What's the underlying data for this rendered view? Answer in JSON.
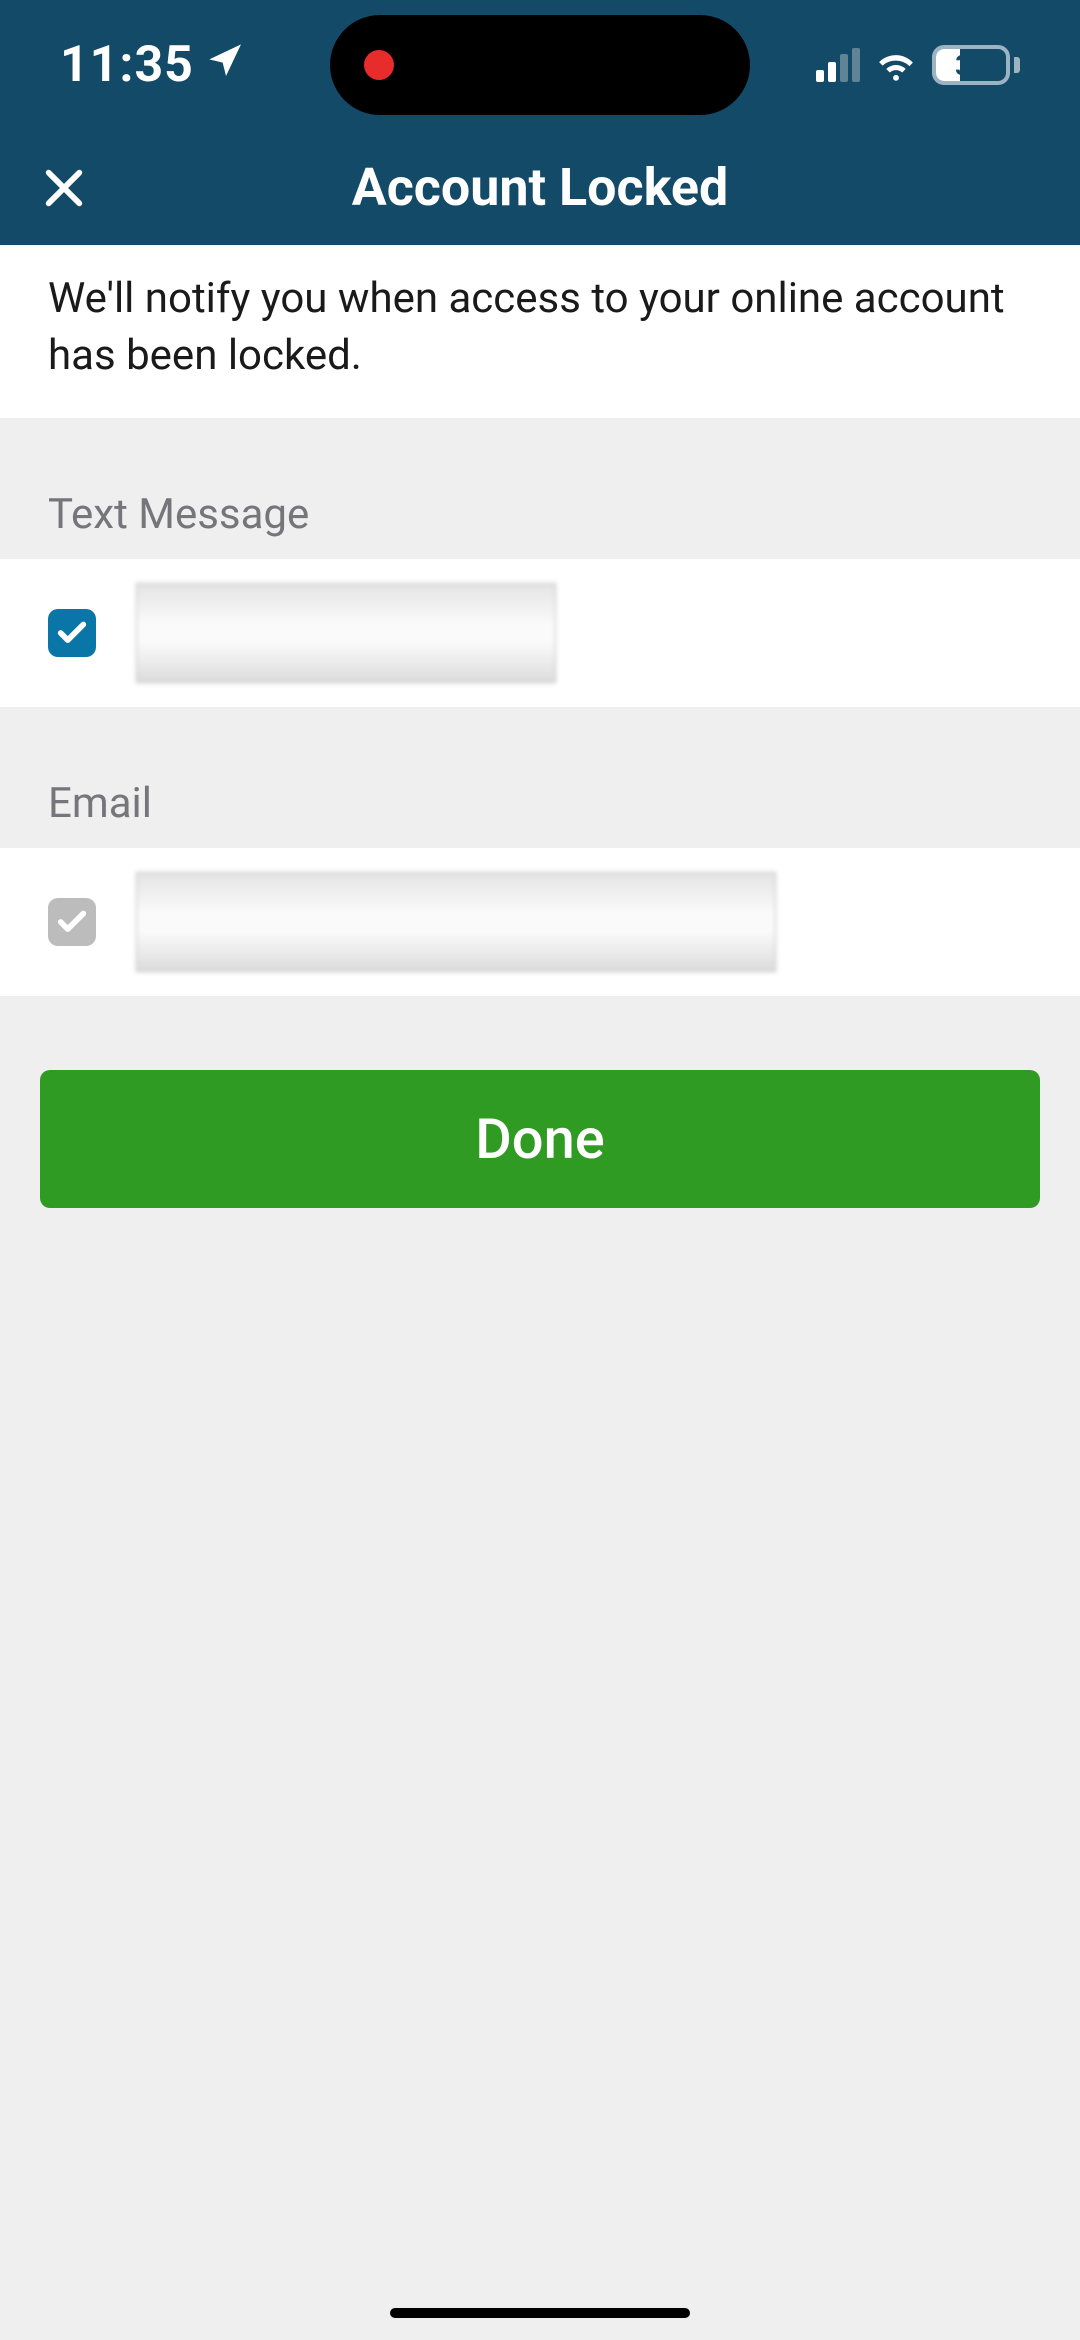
{
  "status_bar": {
    "time": "11:35",
    "battery_percent": "34"
  },
  "header": {
    "title": "Account Locked"
  },
  "description": "We'll notify you when access to your online account has been locked.",
  "sections": {
    "text_message": {
      "label": "Text Message",
      "checked": true
    },
    "email": {
      "label": "Email",
      "checked": false
    }
  },
  "buttons": {
    "done": "Done"
  }
}
